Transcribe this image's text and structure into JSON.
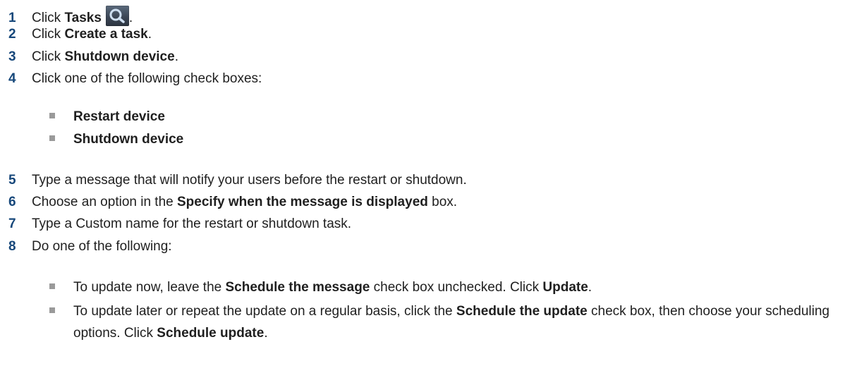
{
  "steps": [
    {
      "num": "1",
      "pre": "Click ",
      "bold": "Tasks",
      "post": "."
    },
    {
      "num": "2",
      "pre": "Click ",
      "bold": "Create a task",
      "post": "."
    },
    {
      "num": "3",
      "pre": "Click ",
      "bold": "Shutdown device",
      "post": "."
    },
    {
      "num": "4",
      "text": "Click one of the following check boxes:"
    },
    {
      "num": "5",
      "text": "Type a message that will notify your users before the restart or shutdown."
    },
    {
      "num": "6",
      "pre": "Choose an option in the ",
      "bold": "Specify when the message is displayed",
      "post": " box."
    },
    {
      "num": "7",
      "text": "Type a Custom name for the restart or shutdown task."
    },
    {
      "num": "8",
      "text": "Do one of the following:"
    }
  ],
  "step4_options": [
    "Restart device",
    "Shutdown device"
  ],
  "step8_options": [
    {
      "t1": "To update now, leave the ",
      "b1": "Schedule the message",
      "t2": " check box unchecked. Click ",
      "b2": "Update",
      "t3": "."
    },
    {
      "t1": "To update later or repeat the update on a regular basis, click the ",
      "b1": "Schedule the update",
      "t2": " check box, then choose your scheduling options. Click ",
      "b2": "Schedule update",
      "t3": "."
    }
  ],
  "icons": {
    "tasks": "search-icon"
  }
}
